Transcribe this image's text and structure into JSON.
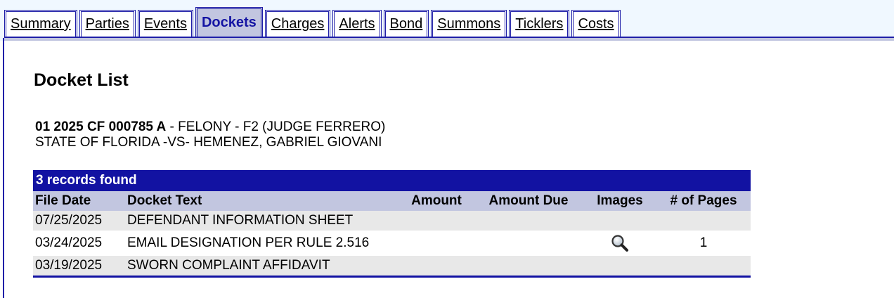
{
  "tabs": [
    {
      "label": "Summary",
      "active": false
    },
    {
      "label": "Parties",
      "active": false
    },
    {
      "label": "Events",
      "active": false
    },
    {
      "label": "Dockets",
      "active": true
    },
    {
      "label": "Charges",
      "active": false
    },
    {
      "label": "Alerts",
      "active": false
    },
    {
      "label": "Bond",
      "active": false
    },
    {
      "label": "Summons",
      "active": false
    },
    {
      "label": "Ticklers",
      "active": false
    },
    {
      "label": "Costs",
      "active": false
    }
  ],
  "page": {
    "title": "Docket List",
    "case_number": "01 2025 CF 000785 A",
    "case_desc": " - FELONY - F2 (JUDGE FERRERO)",
    "case_style": "STATE OF FLORIDA -VS- HEMENEZ, GABRIEL GIOVANI"
  },
  "table": {
    "records_found": "3 records found",
    "headers": {
      "file_date": "File Date",
      "docket_text": "Docket Text",
      "amount": "Amount",
      "amount_due": "Amount Due",
      "images": "Images",
      "pages": "# of Pages"
    },
    "rows": [
      {
        "file_date": "07/25/2025",
        "docket_text": "DEFENDANT INFORMATION SHEET",
        "amount": "",
        "amount_due": "",
        "image_icon": "",
        "pages": ""
      },
      {
        "file_date": "03/24/2025",
        "docket_text": "EMAIL DESIGNATION PER RULE 2.516",
        "amount": "",
        "amount_due": "",
        "image_icon": "magnifier-icon",
        "pages": "1"
      },
      {
        "file_date": "03/19/2025",
        "docket_text": "SWORN COMPLAINT AFFIDAVIT",
        "amount": "",
        "amount_due": "",
        "image_icon": "",
        "pages": ""
      }
    ]
  },
  "colors": {
    "accent": "#1212a2",
    "header_bg": "#c2c6e0",
    "row_alt": "#e8e8e8",
    "topbar": "#f0f8ff"
  }
}
